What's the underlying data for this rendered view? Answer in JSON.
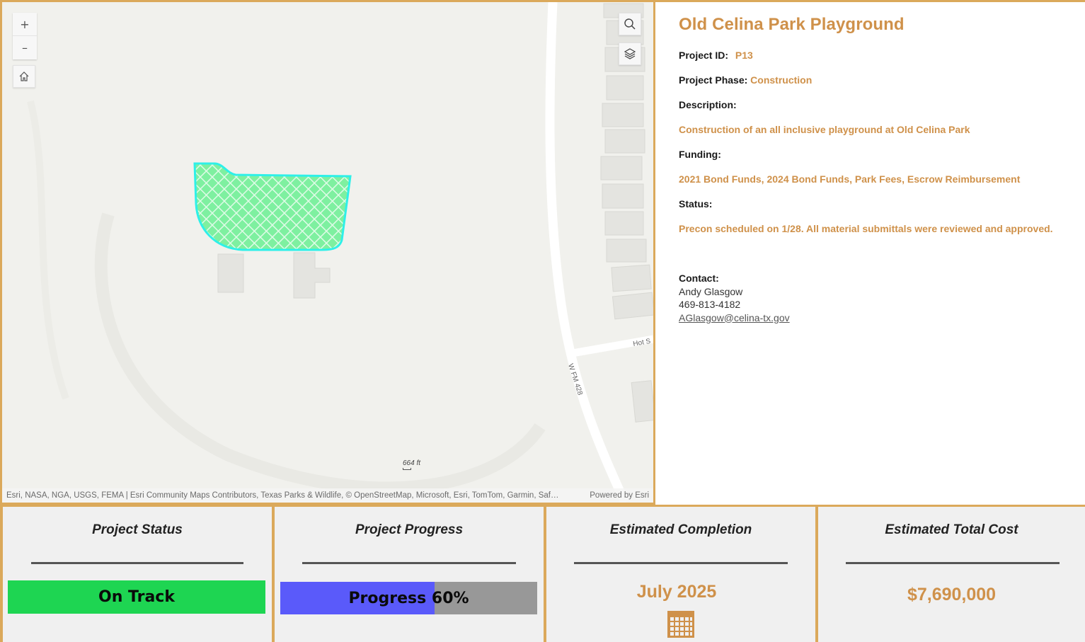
{
  "map": {
    "zoom_in_label": "+",
    "zoom_out_label": "–",
    "attribution": "Esri, NASA, NGA, USGS, FEMA | Esri Community Maps Contributors, Texas Parks & Wildlife, © OpenStreetMap, Microsoft, Esri, TomTom, Garmin, Saf…",
    "powered_by": "Powered by Esri",
    "scale_label": "664 ft",
    "road_label_main": "W FM 428",
    "road_label_side": "Hot S",
    "colors": {
      "background": "#f1f1ed",
      "polygon_fill": "#7ef0a0",
      "polygon_outline": "#2ef0e8",
      "building": "#e4e4e0",
      "road": "#ffffff"
    }
  },
  "project": {
    "title": "Old Celina Park Playground",
    "id_label": "Project ID:",
    "id_value": "P13",
    "phase_label": "Project Phase:",
    "phase_value": "Construction",
    "description_label": "Description:",
    "description_value": "Construction of an all inclusive playground at Old Celina Park",
    "funding_label": "Funding:",
    "funding_value": "2021 Bond Funds, 2024 Bond Funds, Park Fees, Escrow Reimbursement",
    "status_label": "Status:",
    "status_value": "Precon scheduled on 1/28. All material submittals were reviewed and approved.",
    "contact_label": "Contact:",
    "contact_name": "Andy Glasgow",
    "contact_phone": "469-813-4182",
    "contact_email": "AGlasgow@celina-tx.gov"
  },
  "cards": {
    "status": {
      "title": "Project Status",
      "value": "On Track",
      "color": "#1ed552"
    },
    "progress": {
      "title": "Project Progress",
      "label": "Progress 60%",
      "percent": 60,
      "fill_color": "#5a5afa",
      "track_color": "#989898"
    },
    "completion": {
      "title": "Estimated Completion",
      "value": "July 2025",
      "icon": "calendar-icon"
    },
    "cost": {
      "title": "Estimated Total Cost",
      "value": "$7,690,000"
    }
  },
  "colors": {
    "accent": "#cf914a",
    "border": "#dba95b"
  }
}
